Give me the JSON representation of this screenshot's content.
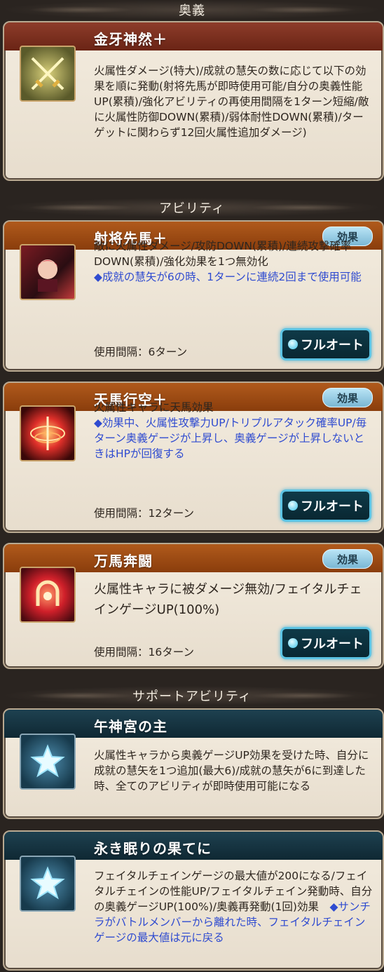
{
  "sections": {
    "ougi": "奥義",
    "ability": "アビリティ",
    "support": "サポートアビリティ"
  },
  "ougi": {
    "name": "金牙神然＋",
    "description": "火属性ダメージ(特大)/成就の慧矢の数に応じて以下の効果を順に発動(射将先馬が即時使用可能/自分の奥義性能UP(累積)/強化アビリティの再使用間隔を1ターン短縮/敵に火属性防御DOWN(累積)/弱体耐性DOWN(累積)/ターゲットに関わらず12回火属性追加ダメージ)"
  },
  "abilities": [
    {
      "name": "射将先馬＋",
      "effect_label": "効果",
      "desc": "敵に火属性ダメージ/攻防DOWN(累積)/連続攻撃確率DOWN(累積)/強化効果を1つ無効化",
      "desc_blue": "◆成就の慧矢が6の時、1ターンに連続2回まで使用可能",
      "cooldown": "使用間隔：6ターン",
      "auto_label": "フルオート"
    },
    {
      "name": "天馬行空＋",
      "effect_label": "効果",
      "desc": "火属性キャラに天馬効果",
      "desc_blue": "◆効果中、火属性攻撃力UP/トリプルアタック確率UP/毎ターン奥義ゲージが上昇し、奥義ゲージが上昇しないときはHPが回復する",
      "cooldown": "使用間隔：12ターン",
      "auto_label": "フルオート"
    },
    {
      "name": "万馬奔闘",
      "effect_label": "効果",
      "desc": "火属性キャラに被ダメージ無効/フェイタルチェインゲージUP(100%)",
      "cooldown": "使用間隔：16ターン",
      "auto_label": "フルオート"
    }
  ],
  "supports": [
    {
      "name": "午神宮の主",
      "desc": "火属性キャラから奥義ゲージUP効果を受けた時、自分に成就の慧矢を1つ追加(最大6)/成就の慧矢が6に到達した時、全てのアビリティが即時使用可能になる"
    },
    {
      "name": "永き眠りの果てに",
      "desc": "フェイタルチェインゲージの最大値が200になる/フェイタルチェインの性能UP/フェイタルチェイン発動時、自分の奥義ゲージUP(100%)/奥義再発動(1回)効果　",
      "desc_blue": "◆サンチラがバトルメンバーから離れた時、フェイタルチェインゲージの最大値は元に戻る"
    }
  ],
  "icons": {
    "ougi": "crossed-swords-icon",
    "ability1": "character-portrait-icon",
    "ability2": "fire-ring-icon",
    "ability3": "horseshoe-icon",
    "support": "star-icon"
  }
}
